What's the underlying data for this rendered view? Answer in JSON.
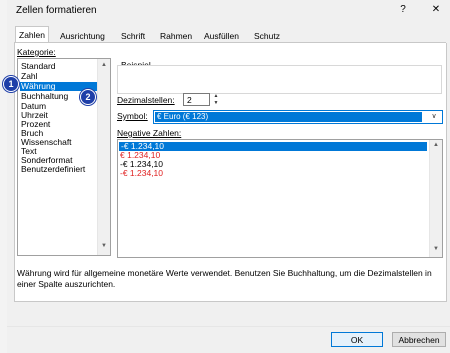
{
  "window": {
    "title": "Zellen formatieren",
    "help_symbol": "?",
    "close_symbol": "✕"
  },
  "tabs": [
    {
      "label": "Zahlen",
      "active": true
    },
    {
      "label": "Ausrichtung",
      "active": false
    },
    {
      "label": "Schrift",
      "active": false
    },
    {
      "label": "Rahmen",
      "active": false
    },
    {
      "label": "Ausfüllen",
      "active": false
    },
    {
      "label": "Schutz",
      "active": false
    }
  ],
  "category": {
    "label": "Kategorie:",
    "items": [
      "Standard",
      "Zahl",
      "Währung",
      "Buchhaltung",
      "Datum",
      "Uhrzeit",
      "Prozent",
      "Bruch",
      "Wissenschaft",
      "Text",
      "Sonderformat",
      "Benutzerdefiniert"
    ],
    "selected": "Währung"
  },
  "sample": {
    "label": "Beispiel",
    "value": ""
  },
  "decimals": {
    "label": "Dezimalstellen:",
    "value": "2"
  },
  "symbol": {
    "label": "Symbol:",
    "value": "€ Euro (€ 123)"
  },
  "negative": {
    "label": "Negative Zahlen:",
    "items": [
      {
        "text": "-€ 1.234,10",
        "color": "#000000",
        "selected": true
      },
      {
        "text": "€ 1.234,10",
        "color": "#e02020",
        "selected": false
      },
      {
        "text": "-€ 1.234,10",
        "color": "#000000",
        "selected": false
      },
      {
        "text": "-€ 1.234,10",
        "color": "#e02020",
        "selected": false
      }
    ]
  },
  "description": "Währung wird für allgemeine monetäre Werte verwendet. Benutzen Sie Buchhaltung, um die Dezimalstellen in einer Spalte auszurichten.",
  "buttons": {
    "ok": "OK",
    "cancel": "Abbrechen"
  },
  "annotations": {
    "badge1": "1",
    "badge2": "2"
  },
  "colors": {
    "selection": "#0078d7",
    "badge": "#1f3fa8",
    "negative_red": "#e02020"
  },
  "icons": {
    "scroll_up": "▲",
    "scroll_down": "▼",
    "combo_dropdown": "∨"
  }
}
